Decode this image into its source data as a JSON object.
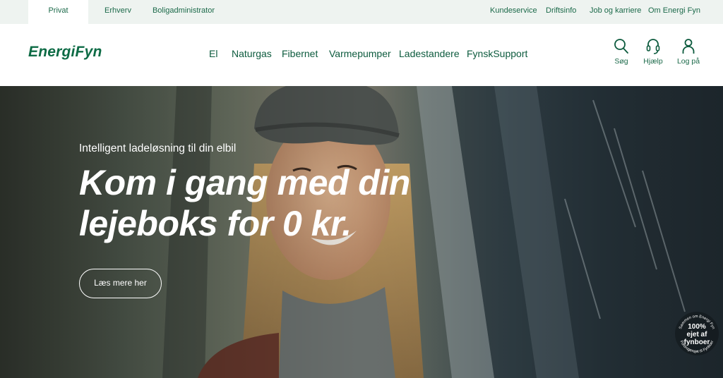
{
  "segments": [
    {
      "label": "Privat",
      "active": true
    },
    {
      "label": "Erhverv",
      "active": false
    },
    {
      "label": "Boligadministrator",
      "active": false
    }
  ],
  "utility_links": [
    "Kundeservice",
    "Driftsinfo",
    "Job og karriere",
    "Om Energi Fyn"
  ],
  "brand": {
    "logo_text": "EnergiFyn",
    "color": "#0d6b45"
  },
  "nav": [
    "El",
    "Naturgas",
    "Fibernet",
    "Varmepumper",
    "Ladestandere",
    "FynskSupport"
  ],
  "tools": {
    "search": {
      "label": "Søg",
      "icon": "search-icon"
    },
    "help": {
      "label": "Hjælp",
      "icon": "headset-icon"
    },
    "login": {
      "label": "Log på",
      "icon": "user-icon"
    }
  },
  "hero": {
    "eyebrow": "Intelligent ladeløsning til din elbil",
    "headline": "Kom i gang med din lejeboks for 0 kr.",
    "cta_label": "Læs mere her"
  },
  "badge": {
    "big_text_1": "100%",
    "big_text_2": "ejet af",
    "big_text_3": "fynboer",
    "ring_top": "Sammen om Energi Fyn",
    "ring_bottom": "Forbrugerejet til Fynboer"
  }
}
